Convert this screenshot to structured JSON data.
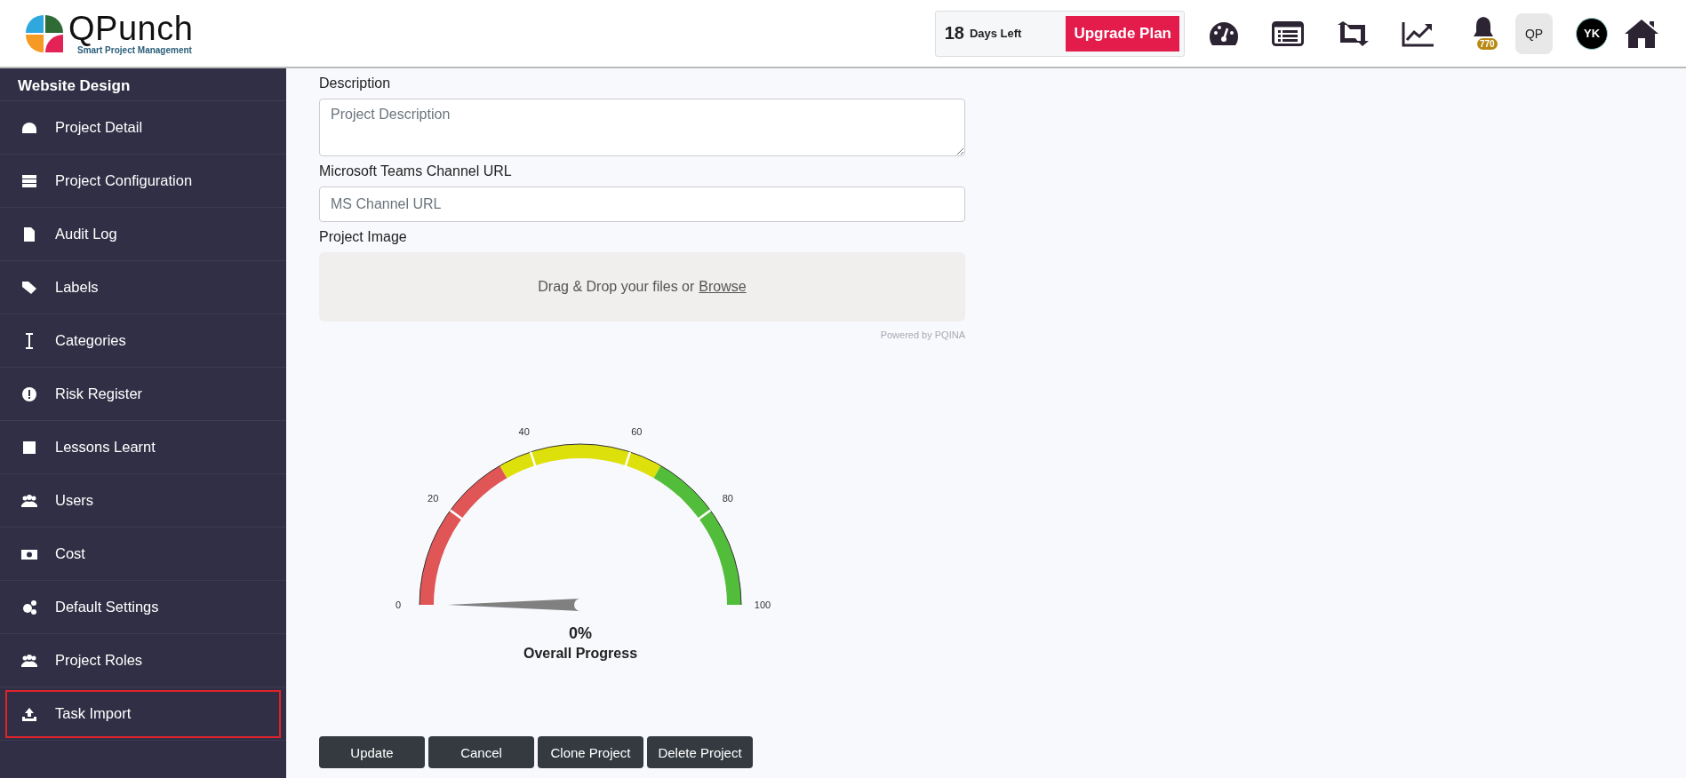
{
  "header": {
    "logo": {
      "name": "QPunch",
      "tagline": "Smart Project Management"
    },
    "trial": {
      "days": "18",
      "label": "Days Left",
      "button": "Upgrade Plan"
    },
    "notifications": {
      "badge": "770"
    },
    "workspace_avatar": "QP",
    "user_avatar": "YK"
  },
  "sidebar": {
    "title": "Website Design",
    "items": [
      {
        "label": "Project Detail",
        "highlighted": false
      },
      {
        "label": "Project Configuration",
        "highlighted": false
      },
      {
        "label": "Audit Log",
        "highlighted": false
      },
      {
        "label": "Labels",
        "highlighted": false
      },
      {
        "label": "Categories",
        "highlighted": false
      },
      {
        "label": "Risk Register",
        "highlighted": false
      },
      {
        "label": "Lessons Learnt",
        "highlighted": false
      },
      {
        "label": "Users",
        "highlighted": false
      },
      {
        "label": "Cost",
        "highlighted": false
      },
      {
        "label": "Default Settings",
        "highlighted": false
      },
      {
        "label": "Project Roles",
        "highlighted": false
      },
      {
        "label": "Task Import",
        "highlighted": true
      }
    ]
  },
  "form": {
    "description": {
      "label": "Description",
      "placeholder": "Project Description"
    },
    "teams_url": {
      "label": "Microsoft Teams Channel URL",
      "placeholder": "MS Channel URL"
    },
    "image": {
      "label": "Project Image",
      "drop_text": "Drag & Drop your files or",
      "browse": "Browse",
      "powered_by": "Powered by PQINA"
    }
  },
  "gauge": {
    "ticks": [
      "0",
      "20",
      "40",
      "60",
      "80",
      "100"
    ],
    "level": 0,
    "value": "0%",
    "label": "Overall Progress"
  },
  "buttons": [
    "Update",
    "Cancel",
    "Clone Project",
    "Delete Project"
  ]
}
